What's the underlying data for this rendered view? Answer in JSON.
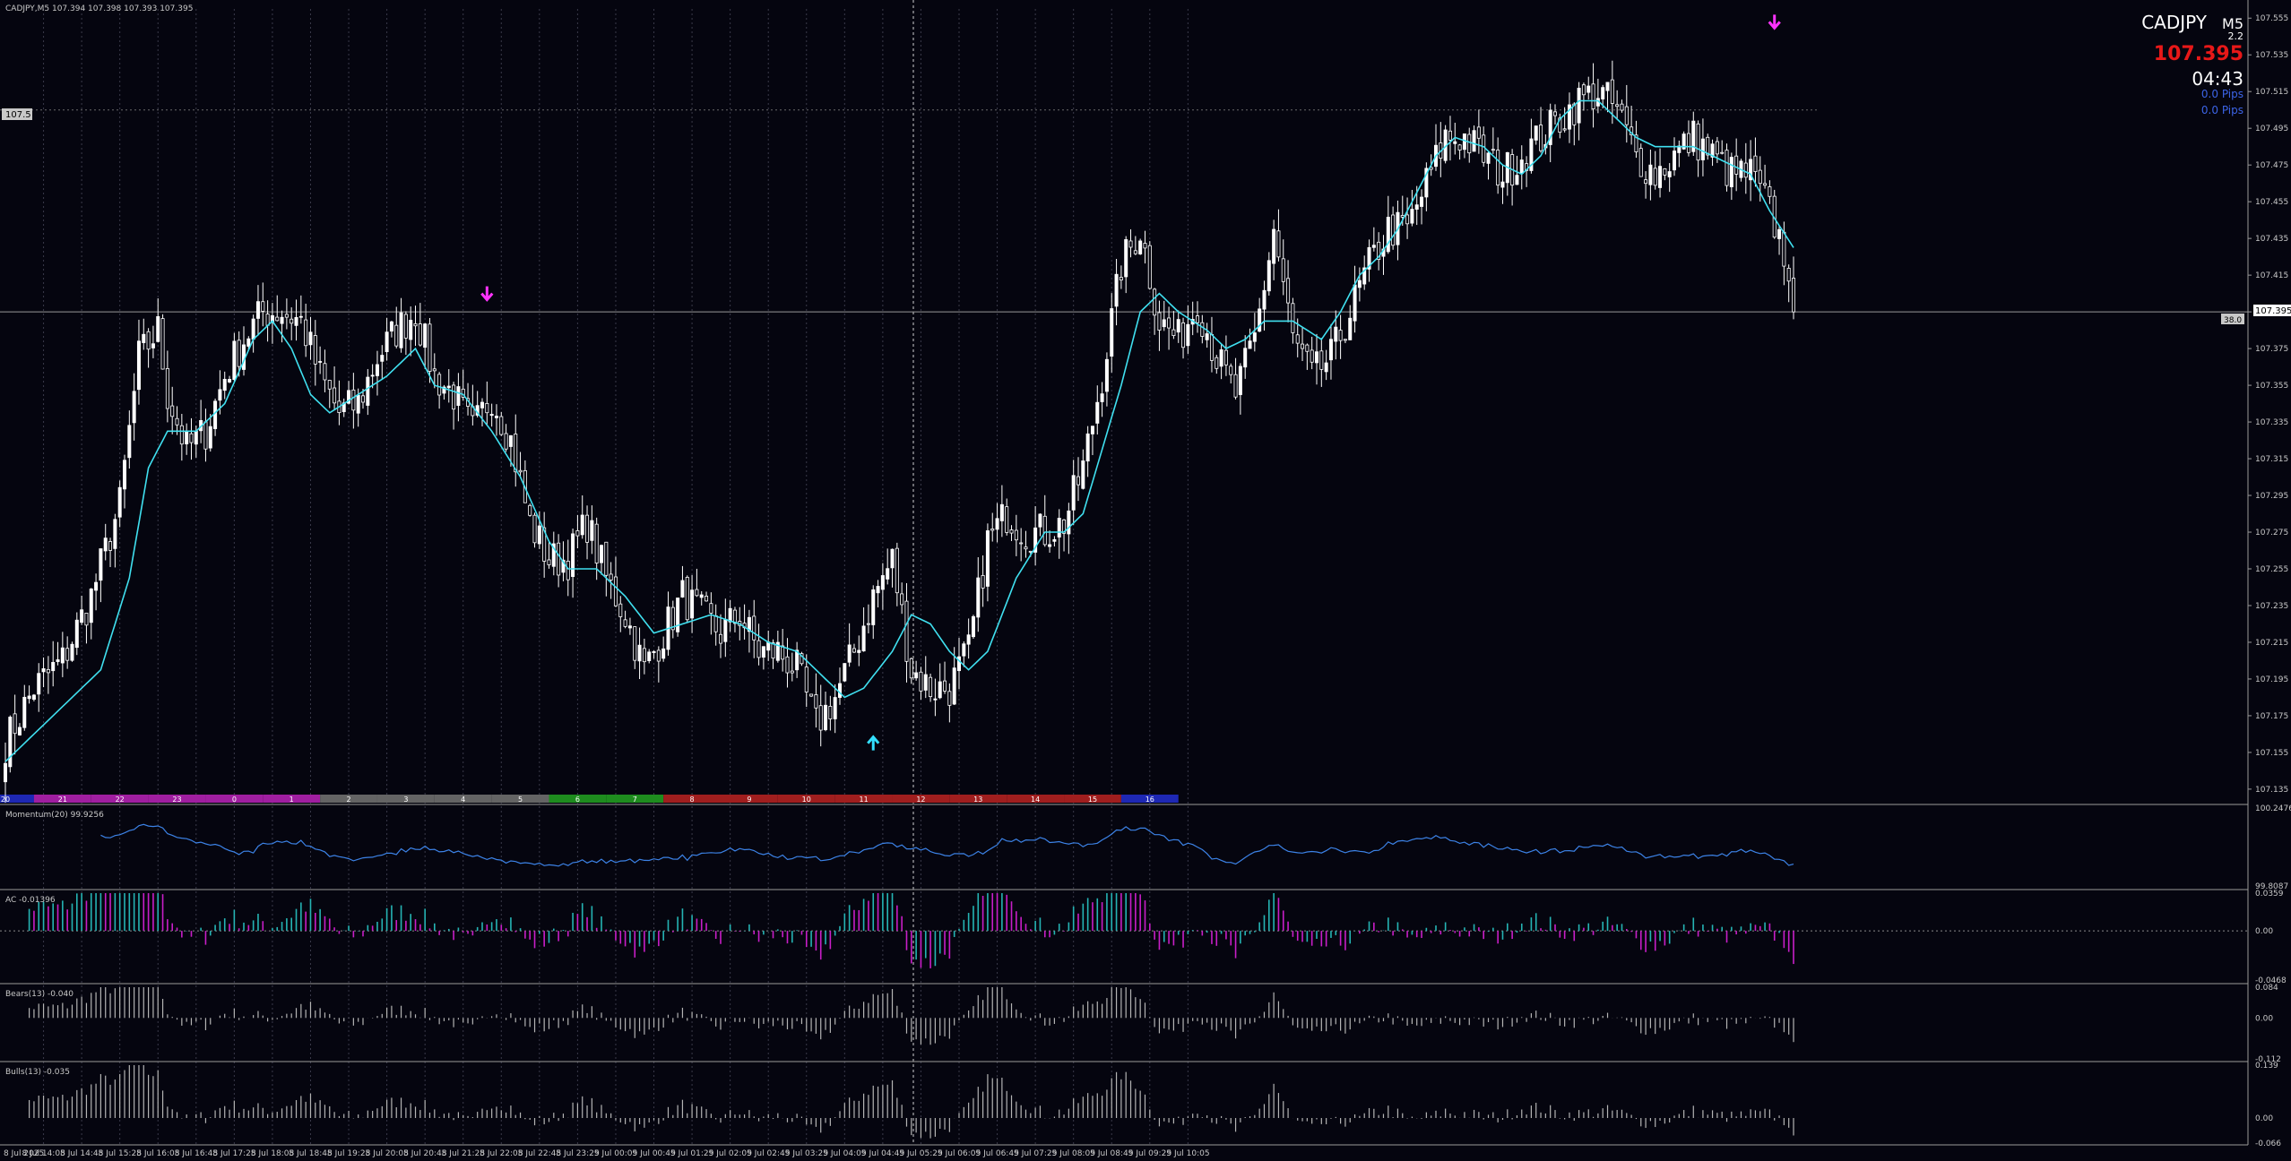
{
  "header": {
    "info": "CADJPY,M5  107.394 107.398 107.393 107.395"
  },
  "quote": {
    "symbol": "CADJPY",
    "timeframe": "M5",
    "spread": "2.2",
    "price": "107.395",
    "countdown": "04:43",
    "pips1": "0.0 Pips",
    "pips2": "0.0 Pips"
  },
  "colors": {
    "background": "#05050f",
    "bull_candle": "#ffffff",
    "bear_candle": "#ffffff",
    "ma_line": "#40e0f0",
    "price_label": "#e81818",
    "arrow_down": "#ff33ff",
    "arrow_up": "#33e0ff",
    "momentum_line": "#3c82e6",
    "ac_up": "#25b4b4",
    "ac_down": "#c81ec8",
    "hist": "#b4b4b4"
  },
  "labels": {
    "left_level": "107.5",
    "right_price": "107.395",
    "right_box": "38.0"
  },
  "chart_data": [
    {
      "type": "candlestick",
      "title": "CADJPY,M5",
      "y_ticks": [
        "107.555",
        "107.535",
        "107.515",
        "107.495",
        "107.475",
        "107.455",
        "107.435",
        "107.415",
        "107.395",
        "107.375",
        "107.355",
        "107.335",
        "107.315",
        "107.295",
        "107.275",
        "107.255",
        "107.235",
        "107.215",
        "107.195",
        "107.175",
        "107.155",
        "107.135"
      ],
      "ylim": [
        107.133,
        107.56
      ],
      "x_ticks": [
        "8 Jul 2025",
        "8 Jul 14:05",
        "8 Jul 14:45",
        "8 Jul 15:25",
        "8 Jul 16:05",
        "8 Jul 16:45",
        "8 Jul 17:25",
        "8 Jul 18:05",
        "8 Jul 18:45",
        "8 Jul 19:25",
        "8 Jul 20:05",
        "8 Jul 20:45",
        "8 Jul 21:25",
        "8 Jul 22:05",
        "8 Jul 22:45",
        "8 Jul 23:25",
        "9 Jul 00:05",
        "9 Jul 00:45",
        "9 Jul 01:25",
        "9 Jul 02:05",
        "9 Jul 02:45",
        "9 Jul 03:25",
        "9 Jul 04:05",
        "9 Jul 04:45",
        "9 Jul 05:25",
        "9 Jul 06:05",
        "9 Jul 06:45",
        "9 Jul 07:25",
        "9 Jul 08:05",
        "9 Jul 08:45",
        "9 Jul 09:25",
        "9 Jul 10:05"
      ],
      "hour_bar": {
        "labels": [
          "20",
          "21",
          "22",
          "23",
          "0",
          "1",
          "2",
          "3",
          "4",
          "5",
          "6",
          "7",
          "8",
          "9",
          "10",
          "11",
          "12",
          "13",
          "14",
          "15",
          "16"
        ],
        "colors": [
          "#1e28b4",
          "#a01ea0",
          "#a01ea0",
          "#a01ea0",
          "#a01ea0",
          "#a01ea0",
          "#646464",
          "#646464",
          "#646464",
          "#646464",
          "#1e8c1e",
          "#1e8c1e",
          "#a01e1e",
          "#a01e1e",
          "#a01e1e",
          "#a01e1e",
          "#a01e1e",
          "#a01e1e",
          "#a01e1e",
          "#a01e1e",
          "#1e28b4"
        ]
      },
      "close_keypoints": [
        [
          0,
          107.16
        ],
        [
          6,
          107.19
        ],
        [
          12,
          107.205
        ],
        [
          18,
          107.24
        ],
        [
          24,
          107.29
        ],
        [
          28,
          107.37
        ],
        [
          32,
          107.385
        ],
        [
          34,
          107.35
        ],
        [
          38,
          107.32
        ],
        [
          42,
          107.33
        ],
        [
          46,
          107.36
        ],
        [
          50,
          107.38
        ],
        [
          54,
          107.395
        ],
        [
          58,
          107.395
        ],
        [
          62,
          107.39
        ],
        [
          66,
          107.36
        ],
        [
          70,
          107.34
        ],
        [
          74,
          107.345
        ],
        [
          78,
          107.37
        ],
        [
          82,
          107.385
        ],
        [
          86,
          107.395
        ],
        [
          90,
          107.36
        ],
        [
          94,
          107.35
        ],
        [
          98,
          107.33
        ],
        [
          102,
          107.35
        ],
        [
          106,
          107.325
        ],
        [
          110,
          107.28
        ],
        [
          114,
          107.26
        ],
        [
          118,
          107.26
        ],
        [
          122,
          107.28
        ],
        [
          126,
          107.25
        ],
        [
          130,
          107.23
        ],
        [
          134,
          107.2
        ],
        [
          138,
          107.22
        ],
        [
          142,
          107.24
        ],
        [
          146,
          107.23
        ],
        [
          150,
          107.22
        ],
        [
          154,
          107.23
        ],
        [
          158,
          107.21
        ],
        [
          162,
          107.21
        ],
        [
          166,
          107.2
        ],
        [
          170,
          107.17
        ],
        [
          174,
          107.185
        ],
        [
          178,
          107.21
        ],
        [
          182,
          107.24
        ],
        [
          186,
          107.26
        ],
        [
          190,
          107.2
        ],
        [
          194,
          107.19
        ],
        [
          198,
          107.19
        ],
        [
          202,
          107.21
        ],
        [
          206,
          107.27
        ],
        [
          210,
          107.285
        ],
        [
          214,
          107.275
        ],
        [
          218,
          107.275
        ],
        [
          222,
          107.28
        ],
        [
          226,
          107.31
        ],
        [
          230,
          107.36
        ],
        [
          234,
          107.42
        ],
        [
          238,
          107.44
        ],
        [
          242,
          107.39
        ],
        [
          246,
          107.38
        ],
        [
          250,
          107.4
        ],
        [
          254,
          107.37
        ],
        [
          258,
          107.35
        ],
        [
          262,
          107.38
        ],
        [
          266,
          107.44
        ],
        [
          270,
          107.38
        ],
        [
          274,
          107.36
        ],
        [
          278,
          107.37
        ],
        [
          282,
          107.395
        ],
        [
          286,
          107.42
        ],
        [
          290,
          107.44
        ],
        [
          294,
          107.44
        ],
        [
          298,
          107.465
        ],
        [
          302,
          107.49
        ],
        [
          306,
          107.49
        ],
        [
          310,
          107.48
        ],
        [
          314,
          107.47
        ],
        [
          318,
          107.48
        ],
        [
          322,
          107.49
        ],
        [
          326,
          107.5
        ],
        [
          330,
          107.51
        ],
        [
          334,
          107.515
        ],
        [
          338,
          107.505
        ],
        [
          342,
          107.48
        ],
        [
          346,
          107.47
        ],
        [
          350,
          107.48
        ],
        [
          354,
          107.49
        ],
        [
          358,
          107.48
        ],
        [
          362,
          107.47
        ],
        [
          366,
          107.47
        ],
        [
          370,
          107.45
        ],
        [
          374,
          107.42
        ],
        [
          375,
          107.395
        ]
      ],
      "ma_keypoints": [
        [
          0,
          107.15
        ],
        [
          10,
          107.175
        ],
        [
          20,
          107.2
        ],
        [
          26,
          107.25
        ],
        [
          30,
          107.31
        ],
        [
          34,
          107.33
        ],
        [
          40,
          107.33
        ],
        [
          46,
          107.345
        ],
        [
          52,
          107.38
        ],
        [
          56,
          107.39
        ],
        [
          60,
          107.375
        ],
        [
          64,
          107.35
        ],
        [
          68,
          107.34
        ],
        [
          74,
          107.35
        ],
        [
          80,
          107.36
        ],
        [
          86,
          107.375
        ],
        [
          90,
          107.355
        ],
        [
          96,
          107.35
        ],
        [
          102,
          107.33
        ],
        [
          108,
          107.305
        ],
        [
          114,
          107.27
        ],
        [
          118,
          107.255
        ],
        [
          124,
          107.255
        ],
        [
          130,
          107.24
        ],
        [
          136,
          107.22
        ],
        [
          142,
          107.225
        ],
        [
          148,
          107.23
        ],
        [
          154,
          107.225
        ],
        [
          160,
          107.215
        ],
        [
          166,
          107.21
        ],
        [
          172,
          107.195
        ],
        [
          176,
          107.185
        ],
        [
          180,
          107.19
        ],
        [
          186,
          107.21
        ],
        [
          190,
          107.23
        ],
        [
          194,
          107.225
        ],
        [
          198,
          107.21
        ],
        [
          202,
          107.2
        ],
        [
          206,
          107.21
        ],
        [
          212,
          107.25
        ],
        [
          218,
          107.275
        ],
        [
          222,
          107.275
        ],
        [
          226,
          107.285
        ],
        [
          230,
          107.32
        ],
        [
          234,
          107.355
        ],
        [
          238,
          107.395
        ],
        [
          242,
          107.405
        ],
        [
          246,
          107.395
        ],
        [
          252,
          107.385
        ],
        [
          256,
          107.375
        ],
        [
          260,
          107.38
        ],
        [
          264,
          107.39
        ],
        [
          270,
          107.39
        ],
        [
          276,
          107.38
        ],
        [
          280,
          107.395
        ],
        [
          284,
          107.415
        ],
        [
          288,
          107.425
        ],
        [
          292,
          107.44
        ],
        [
          296,
          107.46
        ],
        [
          300,
          107.48
        ],
        [
          304,
          107.49
        ],
        [
          310,
          107.485
        ],
        [
          314,
          107.475
        ],
        [
          318,
          107.47
        ],
        [
          322,
          107.48
        ],
        [
          326,
          107.5
        ],
        [
          330,
          107.51
        ],
        [
          334,
          107.51
        ],
        [
          338,
          107.5
        ],
        [
          342,
          107.49
        ],
        [
          346,
          107.485
        ],
        [
          350,
          107.485
        ],
        [
          354,
          107.485
        ],
        [
          358,
          107.48
        ],
        [
          362,
          107.475
        ],
        [
          366,
          107.47
        ],
        [
          370,
          107.45
        ],
        [
          375,
          107.43
        ]
      ],
      "signals": [
        {
          "bar": 101,
          "price": 107.405,
          "dir": "down"
        },
        {
          "bar": 371,
          "price": 107.553,
          "dir": "down"
        },
        {
          "bar": 182,
          "price": 107.16,
          "dir": "up"
        }
      ]
    },
    {
      "type": "line",
      "title": "Momentum(20) 99.9256",
      "y_ticks": [
        "100.2476",
        "99.8087"
      ],
      "ylim": [
        99.8087,
        100.2476
      ]
    },
    {
      "type": "bar",
      "title": "AC -0.01396",
      "y_ticks": [
        "0.0359",
        "0.00",
        "-0.0468"
      ],
      "ylim": [
        -0.0468,
        0.0359
      ]
    },
    {
      "type": "bar",
      "title": "Bears(13) -0.040",
      "y_ticks": [
        "0.084",
        "0.00",
        "-0.112"
      ],
      "ylim": [
        -0.112,
        0.084
      ]
    },
    {
      "type": "bar",
      "title": "Bulls(13) -0.035",
      "y_ticks": [
        "0.139",
        "0.00",
        "-0.066"
      ],
      "ylim": [
        -0.066,
        0.139
      ]
    }
  ]
}
